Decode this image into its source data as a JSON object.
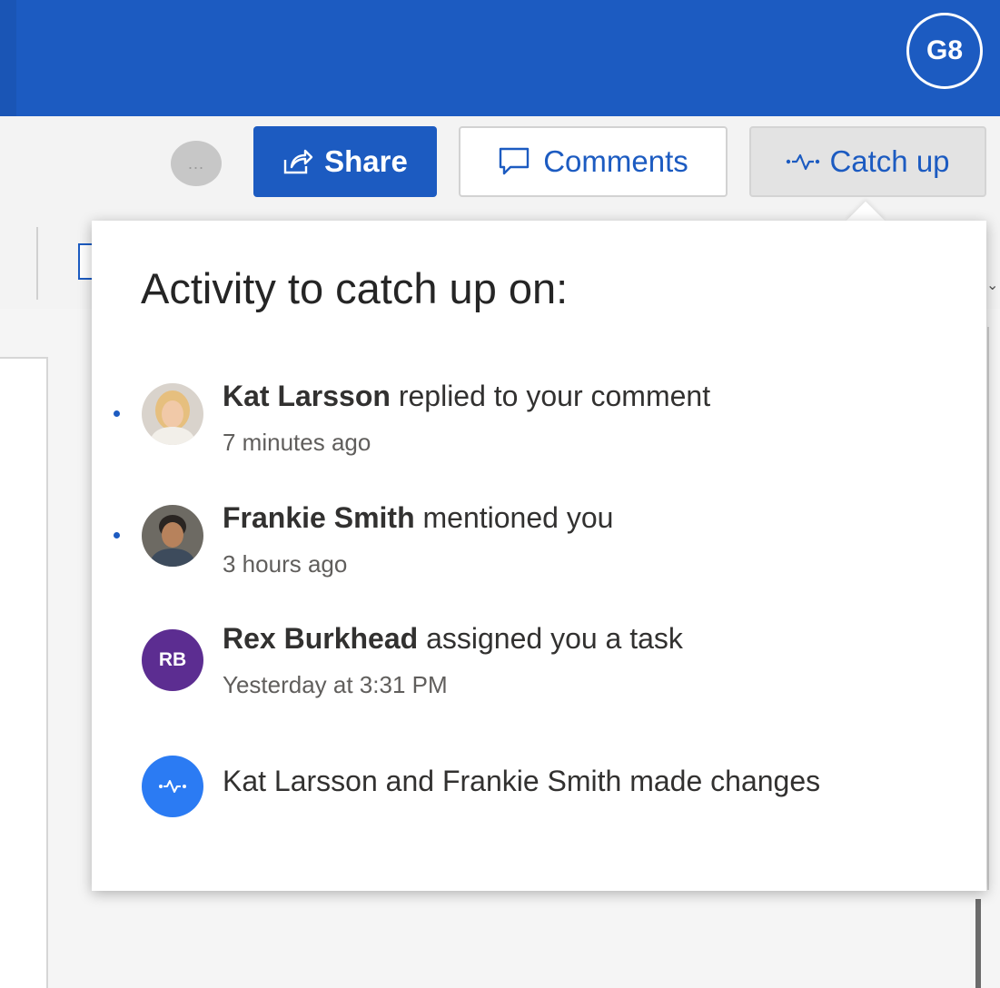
{
  "header": {
    "account_initials": "G8",
    "accent": "#1c5bc1"
  },
  "toolbar": {
    "more_label": "...",
    "share_label": "Share",
    "comments_label": "Comments",
    "catchup_label": "Catch up"
  },
  "popover": {
    "title": "Activity to catch up on:",
    "items": [
      {
        "actor": "Kat Larsson",
        "action": "replied to your comment",
        "time": "7 minutes ago",
        "unread": true,
        "avatar": "photo"
      },
      {
        "actor": "Frankie Smith",
        "action": "mentioned you",
        "time": "3 hours ago",
        "unread": true,
        "avatar": "photo"
      },
      {
        "actor": "Rex Burkhead",
        "action": "assigned you a task",
        "time": "Yesterday at 3:31 PM",
        "unread": false,
        "avatar_initials": "RB",
        "avatar_color": "#5c2d91"
      },
      {
        "summary": "Kat Larsson and Frankie Smith made changes",
        "unread": false,
        "avatar_icon": "activity-icon",
        "avatar_color": "#2b7bf3"
      }
    ]
  }
}
